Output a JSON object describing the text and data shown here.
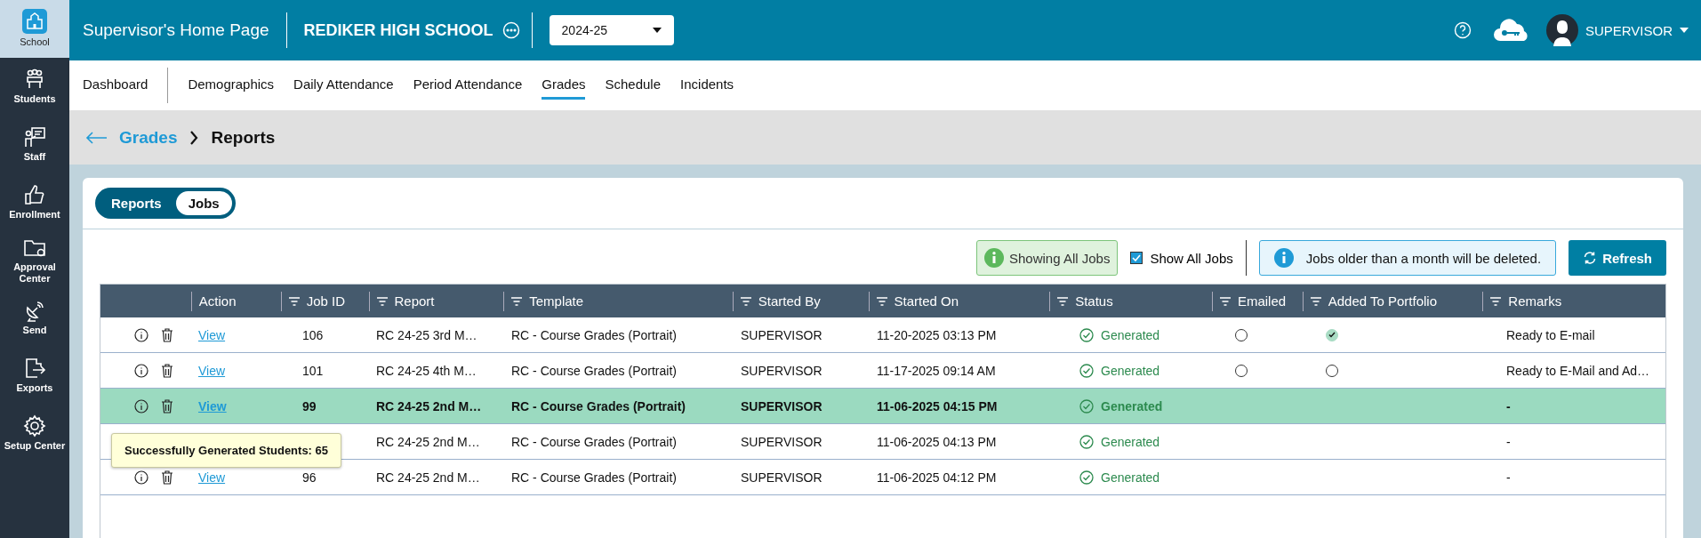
{
  "sidebar": {
    "items": [
      {
        "label": "School",
        "selected": true
      },
      {
        "label": "Students",
        "selected": false
      },
      {
        "label": "Staff",
        "selected": false
      },
      {
        "label": "Enrollment",
        "selected": false
      },
      {
        "label": "Approval Center",
        "selected": false
      },
      {
        "label": "Send",
        "selected": false
      },
      {
        "label": "Exports",
        "selected": false
      },
      {
        "label": "Setup Center",
        "selected": false
      }
    ]
  },
  "header": {
    "title": "Supervisor's Home Page",
    "school": "REDIKER HIGH SCHOOL",
    "year": "2024-25",
    "user": "SUPERVISOR"
  },
  "nav": {
    "items": [
      {
        "label": "Dashboard",
        "selected": false
      },
      {
        "label": "Demographics",
        "selected": false
      },
      {
        "label": "Daily Attendance",
        "selected": false
      },
      {
        "label": "Period Attendance",
        "selected": false
      },
      {
        "label": "Grades",
        "selected": true
      },
      {
        "label": "Schedule",
        "selected": false
      },
      {
        "label": "Incidents",
        "selected": false
      }
    ]
  },
  "breadcrumb": {
    "parent": "Grades",
    "current": "Reports"
  },
  "toggle": [
    {
      "label": "Reports",
      "selected": false
    },
    {
      "label": "Jobs",
      "selected": true
    }
  ],
  "toolbar": {
    "badge": "Showing All Jobs",
    "show_all": {
      "label": "Show All Jobs",
      "checked": true
    },
    "notice": "Jobs older than a month will be deleted.",
    "refresh": "Refresh"
  },
  "table": {
    "columns": [
      {
        "label": "Action",
        "filter": false
      },
      {
        "label": "Job ID",
        "filter": true
      },
      {
        "label": "Report",
        "filter": true
      },
      {
        "label": "Template",
        "filter": true
      },
      {
        "label": "Started By",
        "filter": true
      },
      {
        "label": "Started On",
        "filter": true
      },
      {
        "label": "Status",
        "filter": true
      },
      {
        "label": "Emailed",
        "filter": true
      },
      {
        "label": "Added To Portfolio",
        "filter": true
      },
      {
        "label": "Remarks",
        "filter": true
      }
    ],
    "rows": [
      {
        "selected": false,
        "view": "View",
        "job_id": "106",
        "report": "RC 24-25 3rd M…",
        "template": "RC - Course Grades (Portrait)",
        "started_by": "SUPERVISOR",
        "started_on": "11-20-2025 03:13 PM",
        "status": "Generated",
        "emailed": {
          "checked": false
        },
        "portfolio": {
          "checked": true
        },
        "remarks": "Ready to E-mail"
      },
      {
        "selected": false,
        "view": "View",
        "job_id": "101",
        "report": "RC 24-25 4th M…",
        "template": "RC - Course Grades (Portrait)",
        "started_by": "SUPERVISOR",
        "started_on": "11-17-2025 09:14 AM",
        "status": "Generated",
        "emailed": {
          "checked": false
        },
        "portfolio": {
          "checked": false
        },
        "remarks": "Ready to E-Mail and Ad…"
      },
      {
        "selected": true,
        "view": "View",
        "job_id": "99",
        "report": "RC 24-25 2nd M…",
        "template": "RC - Course Grades (Portrait)",
        "started_by": "SUPERVISOR",
        "started_on": "11-06-2025 04:15 PM",
        "status": "Generated",
        "remarks": "-"
      },
      {
        "selected": false,
        "report": "RC 24-25 2nd M…",
        "template": "RC - Course Grades (Portrait)",
        "started_by": "SUPERVISOR",
        "started_on": "11-06-2025 04:13 PM",
        "status": "Generated",
        "remarks": "-"
      },
      {
        "selected": false,
        "view": "View",
        "job_id": "96",
        "report": "RC 24-25 2nd M…",
        "template": "RC - Course Grades (Portrait)",
        "started_by": "SUPERVISOR",
        "started_on": "11-06-2025 04:12 PM",
        "status": "Generated",
        "remarks": "-"
      }
    ]
  },
  "tooltip": "Successfully Generated Students: 65"
}
